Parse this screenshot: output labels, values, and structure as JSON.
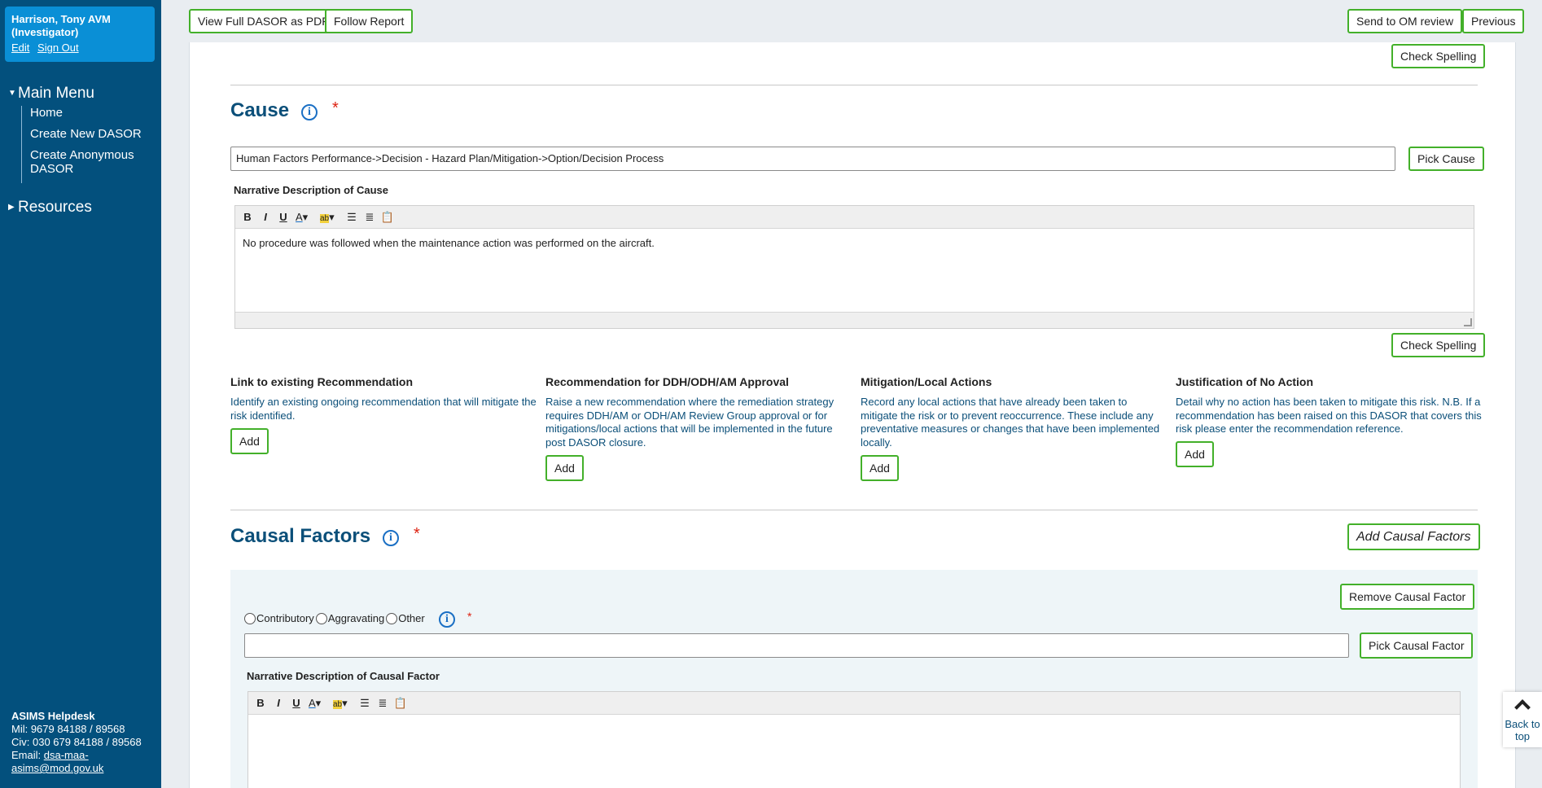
{
  "user": {
    "name": "Harrison, Tony AVM (Investigator)",
    "edit_label": "Edit",
    "signout_label": "Sign Out"
  },
  "nav": {
    "main_menu_label": "Main Menu",
    "items": [
      "Home",
      "Create New DASOR",
      "Create Anonymous DASOR"
    ],
    "resources_label": "Resources"
  },
  "helpdesk": {
    "title": "ASIMS Helpdesk",
    "mil": "Mil: 9679 84188 / 89568",
    "civ": "Civ: 030 679 84188 / 89568",
    "email_label": "Email:",
    "email": "dsa-maa-asims@mod.gov.uk"
  },
  "toolbar": {
    "view_pdf": "View Full DASOR as PDF",
    "follow": "Follow Report",
    "send_om": "Send to OM review",
    "previous": "Previous"
  },
  "check_spelling": "Check Spelling",
  "cause": {
    "title": "Cause",
    "required_mark": "*",
    "value": "Human Factors Performance->Decision - Hazard Plan/Mitigation->Option/Decision Process",
    "pick_label": "Pick Cause",
    "narrative_label": "Narrative Description of Cause",
    "narrative_text": "No procedure was followed when the maintenance action was performed on the aircraft."
  },
  "actions": [
    {
      "title": "Link to existing Recommendation",
      "desc": "Identify an existing ongoing recommendation that will mitigate the risk identified.",
      "button": "Add"
    },
    {
      "title": "Recommendation for DDH/ODH/AM Approval",
      "desc": "Raise a new recommendation where the remediation strategy requires DDH/AM or ODH/AM Review Group approval or for mitigations/local actions that will be implemented in the future post DASOR closure.",
      "button": "Add"
    },
    {
      "title": "Mitigation/Local Actions",
      "desc": "Record any local actions that have already been taken to mitigate the risk or to prevent reoccurrence. These include any preventative measures or changes that have been implemented locally.",
      "button": "Add"
    },
    {
      "title": "Justification of No Action",
      "desc": "Detail why no action has been taken to mitigate this risk. N.B. If a recommendation has been raised on this DASOR that covers this risk please enter the recommendation reference.",
      "button": "Add"
    }
  ],
  "causal": {
    "title": "Causal Factors",
    "required_mark": "*",
    "add_label": "Add Causal Factors",
    "remove_label": "Remove Causal Factor",
    "radios": [
      "Contributory",
      "Aggravating",
      "Other"
    ],
    "value": "",
    "pick_label": "Pick Causal Factor",
    "narrative_label": "Narrative Description of Causal Factor"
  },
  "back_to_top": "Back to top",
  "editor_buttons": {
    "bold": "B",
    "italic": "I",
    "underline": "U",
    "font_color": "A"
  },
  "info_glyph": "i",
  "colors": {
    "sidebar": "#03507d",
    "user_box": "#0a8fd6",
    "button_border": "#43b02a",
    "heading": "#0b4f79",
    "required": "#dd2211"
  }
}
